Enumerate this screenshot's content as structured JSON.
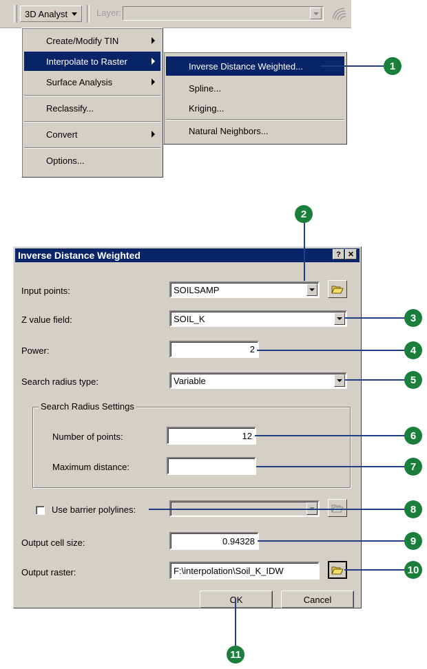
{
  "toolbar": {
    "menu_button_label": "3D Analyst",
    "layer_label": "Layer:",
    "layer_value": ""
  },
  "menu": {
    "items": [
      {
        "label": "Create/Modify TIN",
        "submenu": true
      },
      {
        "label": "Interpolate to Raster",
        "submenu": true,
        "highlighted": true
      },
      {
        "label": "Surface Analysis",
        "submenu": true
      },
      {
        "label": "Reclassify..."
      },
      {
        "label": "Convert",
        "submenu": true
      },
      {
        "label": "Options..."
      }
    ],
    "submenu_items": [
      {
        "label": "Inverse Distance Weighted...",
        "highlighted": true
      },
      {
        "label": "Spline..."
      },
      {
        "label": "Kriging..."
      },
      {
        "label": "Natural Neighbors..."
      }
    ]
  },
  "dialog": {
    "title": "Inverse Distance Weighted",
    "help_button": "?",
    "close_button": "✕",
    "input_points": {
      "label": "Input points:",
      "value": "SOILSAMP"
    },
    "z_value_field": {
      "label": "Z value field:",
      "value": "SOIL_K"
    },
    "power": {
      "label": "Power:",
      "value": "2"
    },
    "search_radius_type": {
      "label": "Search radius type:",
      "value": "Variable"
    },
    "search_radius_settings": {
      "title": "Search Radius Settings",
      "number_of_points": {
        "label": "Number of points:",
        "value": "12"
      },
      "maximum_distance": {
        "label": "Maximum distance:",
        "value": ""
      }
    },
    "barrier": {
      "label": "Use barrier polylines:",
      "checked": false,
      "value": ""
    },
    "output_cell_size": {
      "label": "Output cell size:",
      "value": "0.94328"
    },
    "output_raster": {
      "label": "Output raster:",
      "value": "F:\\interpolation\\Soil_K_IDW"
    },
    "ok_label": "OK",
    "cancel_label": "Cancel"
  },
  "callouts": [
    "1",
    "2",
    "3",
    "4",
    "5",
    "6",
    "7",
    "8",
    "9",
    "10",
    "11"
  ],
  "colors": {
    "callout_green": "#1b7f3c",
    "leader_line": "#1f3f82",
    "highlight": "#0a246a",
    "face": "#d4d0c8"
  }
}
